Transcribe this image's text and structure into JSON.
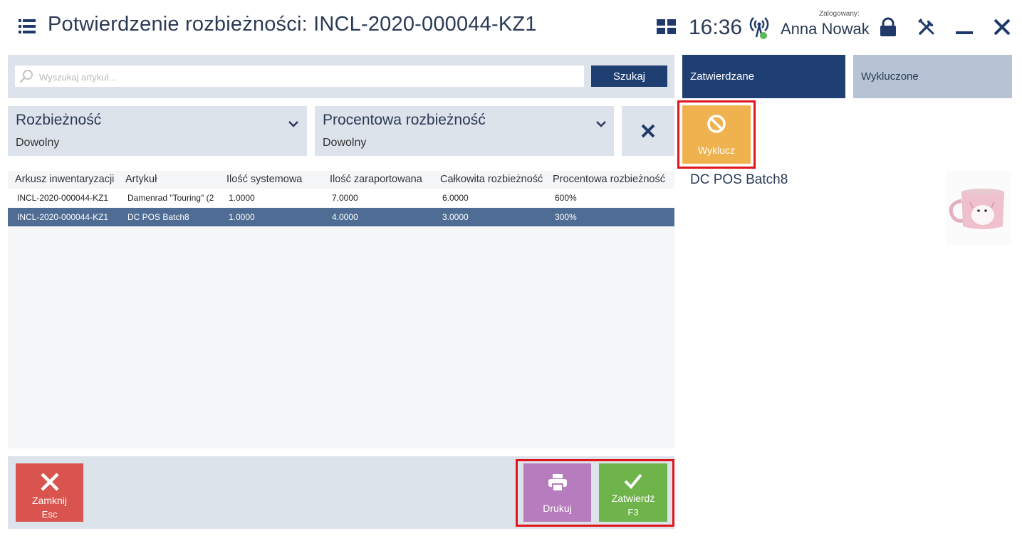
{
  "header": {
    "title": "Potwierdzenie rozbieżności: INCL-2020-000044-KZ1",
    "time": "16:36",
    "logged_in_caption": "Zalogowany:",
    "user_name": "Anna Nowak"
  },
  "search": {
    "placeholder": "Wyszukaj artykuł...",
    "button_label": "Szukaj"
  },
  "filters": [
    {
      "label": "Rozbieżność",
      "value": "Dowolny"
    },
    {
      "label": "Procentowa rozbieżność",
      "value": "Dowolny"
    }
  ],
  "table": {
    "columns": [
      "Arkusz inwentaryzacji",
      "Artykuł",
      "Ilość systemowa",
      "Ilość zaraportowana",
      "Całkowita rozbieżność",
      "Procentowa rozbieżność"
    ],
    "rows": [
      {
        "sheet": "INCL-2020-000044-KZ1",
        "item": "Damenrad \"Touring\" (2",
        "system_qty": "1.0000",
        "reported_qty": "7.0000",
        "total_diff": "6.0000",
        "percent_diff": "600%",
        "selected": false
      },
      {
        "sheet": "INCL-2020-000044-KZ1",
        "item": "DC POS Batch8",
        "system_qty": "1.0000",
        "reported_qty": "4.0000",
        "total_diff": "3.0000",
        "percent_diff": "300%",
        "selected": true
      }
    ]
  },
  "actions": {
    "close": {
      "label": "Zamknij",
      "shortcut": "Esc"
    },
    "print": {
      "label": "Drukuj"
    },
    "confirm": {
      "label": "Zatwierdź",
      "shortcut": "F3"
    }
  },
  "right_panel": {
    "tabs": [
      {
        "label": "Zatwierdzane",
        "active": true
      },
      {
        "label": "Wykluczone",
        "active": false
      }
    ],
    "exclude_button": "Wyklucz",
    "selected_item_name": "DC POS Batch8"
  },
  "colors": {
    "navy": "#1f3f73",
    "panel_gray": "#dde3ea",
    "selected_row": "#4f6d94",
    "close_red": "#d9534f",
    "print_purple": "#b77cbd",
    "confirm_green": "#6fb34b",
    "exclude_orange": "#f0b24f",
    "highlight_red": "#e0161d"
  },
  "icons": {
    "menu": "hamburger-icon",
    "layout": "grid-icon",
    "connection": "signal-icon",
    "lock": "lock-icon",
    "settings": "tools-icon",
    "minimize": "minimize-icon",
    "close": "close-icon",
    "search": "search-icon",
    "print": "printer-icon",
    "confirm": "checkmark-icon",
    "exclude": "ban-icon"
  }
}
